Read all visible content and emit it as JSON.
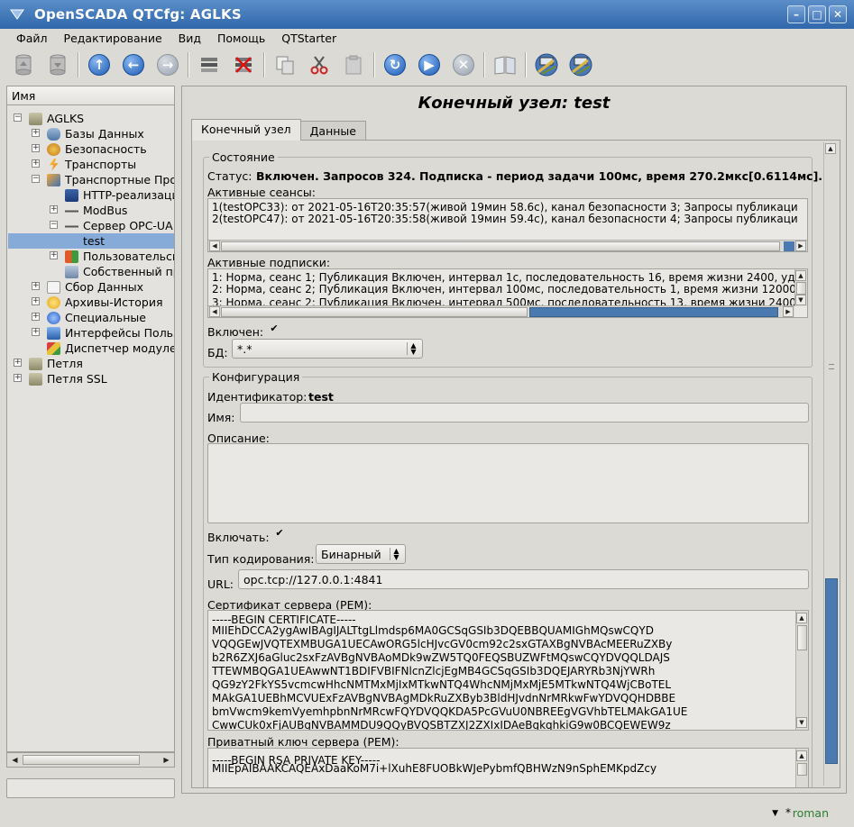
{
  "window": {
    "title": "OpenSCADA QTCfg: AGLKS",
    "buttons": {
      "minimize": "–",
      "maximize": "□",
      "close": "✕"
    }
  },
  "menu": [
    "Файл",
    "Редактирование",
    "Вид",
    "Помощь",
    "QTStarter"
  ],
  "toolbar_icons": [
    "db-load-icon",
    "db-save-icon",
    "up-icon",
    "back-icon",
    "forward-icon",
    "add-item-icon",
    "delete-item-icon",
    "copy-icon",
    "cut-icon",
    "paste-icon",
    "refresh-icon",
    "start-icon",
    "stop-icon",
    "manual-icon",
    "module-icon-1",
    "module-icon-2"
  ],
  "tree": {
    "header": "Имя",
    "items": [
      {
        "label": "AGLKS",
        "level": 0,
        "expanded": true
      },
      {
        "label": "Базы Данных",
        "level": 1,
        "expanded": false
      },
      {
        "label": "Безопасность",
        "level": 1,
        "expanded": false
      },
      {
        "label": "Транспорты",
        "level": 1,
        "expanded": false
      },
      {
        "label": "Транспортные Про",
        "level": 1,
        "expanded": true
      },
      {
        "label": "HTTP-реализаци",
        "level": 2
      },
      {
        "label": "ModBus",
        "level": 2,
        "expanded": false
      },
      {
        "label": "Сервер OPC-UA",
        "level": 2,
        "expanded": true
      },
      {
        "label": "test",
        "level": 3,
        "selected": true
      },
      {
        "label": "Пользовательск",
        "level": 2,
        "expanded": false
      },
      {
        "label": "Собственный пр",
        "level": 2
      },
      {
        "label": "Сбор Данных",
        "level": 1,
        "expanded": false
      },
      {
        "label": "Архивы-История",
        "level": 1,
        "expanded": false
      },
      {
        "label": "Специальные",
        "level": 1,
        "expanded": false
      },
      {
        "label": "Интерфейсы Польз",
        "level": 1,
        "expanded": false
      },
      {
        "label": "Диспетчер модуле",
        "level": 1
      },
      {
        "label": "Петля",
        "level": 0,
        "expanded": false
      },
      {
        "label": "Петля SSL",
        "level": 0,
        "expanded": false
      }
    ]
  },
  "page": {
    "title": "Конечный узел: test",
    "tabs": [
      "Конечный узел",
      "Данные"
    ],
    "state": {
      "title": "Состояние",
      "status_label": "Статус:",
      "status_value": "Включен. Запросов 324. Подписка - период задачи 100мс, время 270.2мкс[0.6114мс].",
      "sessions_label": "Активные сеансы:",
      "sessions": [
        "1(testOPC33): от 2021-05-16T20:35:57(живой 19мин 58.6с), канал безопасности 3; Запросы публикаци",
        "2(testOPC47): от 2021-05-16T20:35:58(живой 19мин 59.4с), канал безопасности 4; Запросы публикаци"
      ],
      "subscriptions_label": "Активные подписки:",
      "subscriptions": [
        "1: Норма, сеанс 1; Публикация Включен, интервал 1с, последовательность 16, время жизни 2400, уд",
        "2: Норма, сеанс 2; Публикация Включен, интервал 100мс, последовательность 1, время жизни 12000",
        "3: Норма, сеанс 2; Публикация Включен, интервал 500мс, последовательность 13, время жизни 2400"
      ],
      "enabled_label": "Включен:",
      "enabled": true,
      "db_label": "БД:",
      "db_value": "*.*"
    },
    "config": {
      "title": "Конфигурация",
      "id_label": "Идентификатор:",
      "id_value": "test",
      "name_label": "Имя:",
      "name_value": "",
      "descr_label": "Описание:",
      "descr_value": "",
      "to_enable_label": "Включать:",
      "to_enable": true,
      "encoding_label": "Тип кодирования:",
      "encoding_value": "Бинарный",
      "url_label": "URL:",
      "url_value": "opc.tcp://127.0.0.1:4841",
      "cert_label": "Сертификат сервера (PEM):",
      "cert_lines": [
        "-----BEGIN CERTIFICATE-----",
        "MIIEhDCCA2ygAwIBAgIJALTtgLlmdsp6MA0GCSqGSIb3DQEBBQUAMIGhMQswCQYD",
        "VQQGEwJVQTEXMBUGA1UECAwORG5lcHJvcGV0cm92c2sxGTAXBgNVBAcMEERuZXBy",
        "b2R6ZXJ6aGluc2sxFzAVBgNVBAoMDk9wZW5TQ0FEQSBUZWFtMQswCQYDVQQLDAJS",
        "TTEWMBQGA1UEAwwNT1BDIFVBIFNlcnZlcjEgMB4GCSqGSIb3DQEJARYRb3NjYWRh",
        "QG9zY2FkYS5vcmcwHhcNMTMxMjIxMTkwNTQ4WhcNMjMxMjE5MTkwNTQ4WjCBoTEL",
        "MAkGA1UEBhMCVUExFzAVBgNVBAgMDkRuZXByb3BldHJvdnNrMRkwFwYDVQQHDBBE",
        "bmVwcm9kemVyemhpbnNrMRcwFQYDVQQKDA5PcGVuU0NBREEgVGVhbTELMAkGA1UE",
        "CwwCUk0xFjAUBgNVBAMMDU9QQyBVQSBTZXJ2ZXIxIDAeBgkqhkiG9w0BCQEWEW9z"
      ],
      "key_label": "Приватный ключ сервера (PEM):",
      "key_lines": [
        "-----BEGIN RSA PRIVATE KEY-----",
        "MIIEpAIBAAKCAQEAxDaaKoM7i+lXuhE8FUOBkWJePybmfQBHWzN9nSphEMKpdZcy"
      ]
    }
  },
  "status": {
    "user": "roman",
    "marker": "*"
  }
}
